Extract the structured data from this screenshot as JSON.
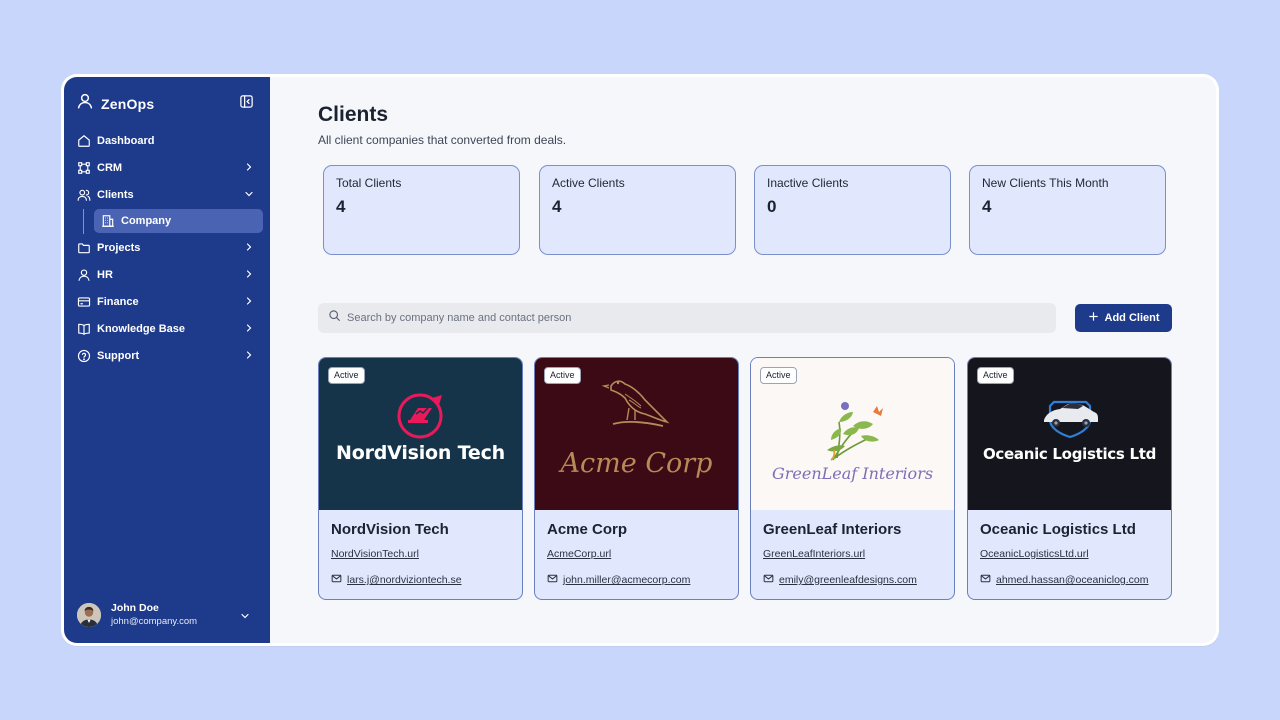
{
  "app": {
    "name": "ZenOps"
  },
  "sidebar": {
    "items": [
      {
        "label": "Dashboard",
        "icon": "home-icon"
      },
      {
        "label": "CRM",
        "icon": "crm-icon"
      },
      {
        "label": "Clients",
        "icon": "users-icon"
      },
      {
        "label": "Company",
        "icon": "building-icon"
      },
      {
        "label": "Projects",
        "icon": "folder-icon"
      },
      {
        "label": "HR",
        "icon": "user-icon"
      },
      {
        "label": "Finance",
        "icon": "credit-card-icon"
      },
      {
        "label": "Knowledge Base",
        "icon": "book-icon"
      },
      {
        "label": "Support",
        "icon": "help-circle-icon"
      }
    ]
  },
  "user": {
    "name": "John Doe",
    "email": "john@company.com"
  },
  "page": {
    "title": "Clients",
    "subtitle": "All client companies that converted from deals."
  },
  "stats": [
    {
      "label": "Total Clients",
      "value": "4"
    },
    {
      "label": "Active Clients",
      "value": "4"
    },
    {
      "label": "Inactive Clients",
      "value": "0"
    },
    {
      "label": "New Clients This Month",
      "value": "4"
    }
  ],
  "search": {
    "placeholder": "Search by company name and contact person",
    "value": ""
  },
  "actions": {
    "add_client": "Add Client"
  },
  "clients": [
    {
      "name": "NordVision Tech",
      "status": "Active",
      "logo_text": "NordVision Tech",
      "url": "NordVisionTech.url",
      "email": "lars.j@nordviziontech.se"
    },
    {
      "name": "Acme Corp",
      "status": "Active",
      "logo_text": "Acme Corp",
      "url": "AcmeCorp.url",
      "email": "john.miller@acmecorp.com"
    },
    {
      "name": "GreenLeaf Interiors",
      "status": "Active",
      "logo_text": "GreenLeaf Interiors",
      "url": "GreenLeafInteriors.url",
      "email": "emily@greenleafdesigns.com"
    },
    {
      "name": "Oceanic Logistics Ltd",
      "status": "Active",
      "logo_text": "Oceanic Logistics Ltd",
      "url": "OceanicLogisticsLtd.url",
      "email": "ahmed.hassan@oceaniclog.com"
    }
  ],
  "colors": {
    "background": "#c9d6fb",
    "sidebar": "#1e3a8a",
    "sidebar_active": "#4a64b3",
    "card_fill": "#e1e8fd",
    "card_border": "#6a7fbd",
    "logo_bg_nordvision": "#15344a",
    "logo_bg_acme": "#3b0a15",
    "logo_bg_greenleaf": "#fcf8f6",
    "logo_bg_oceanic": "#15151d"
  }
}
